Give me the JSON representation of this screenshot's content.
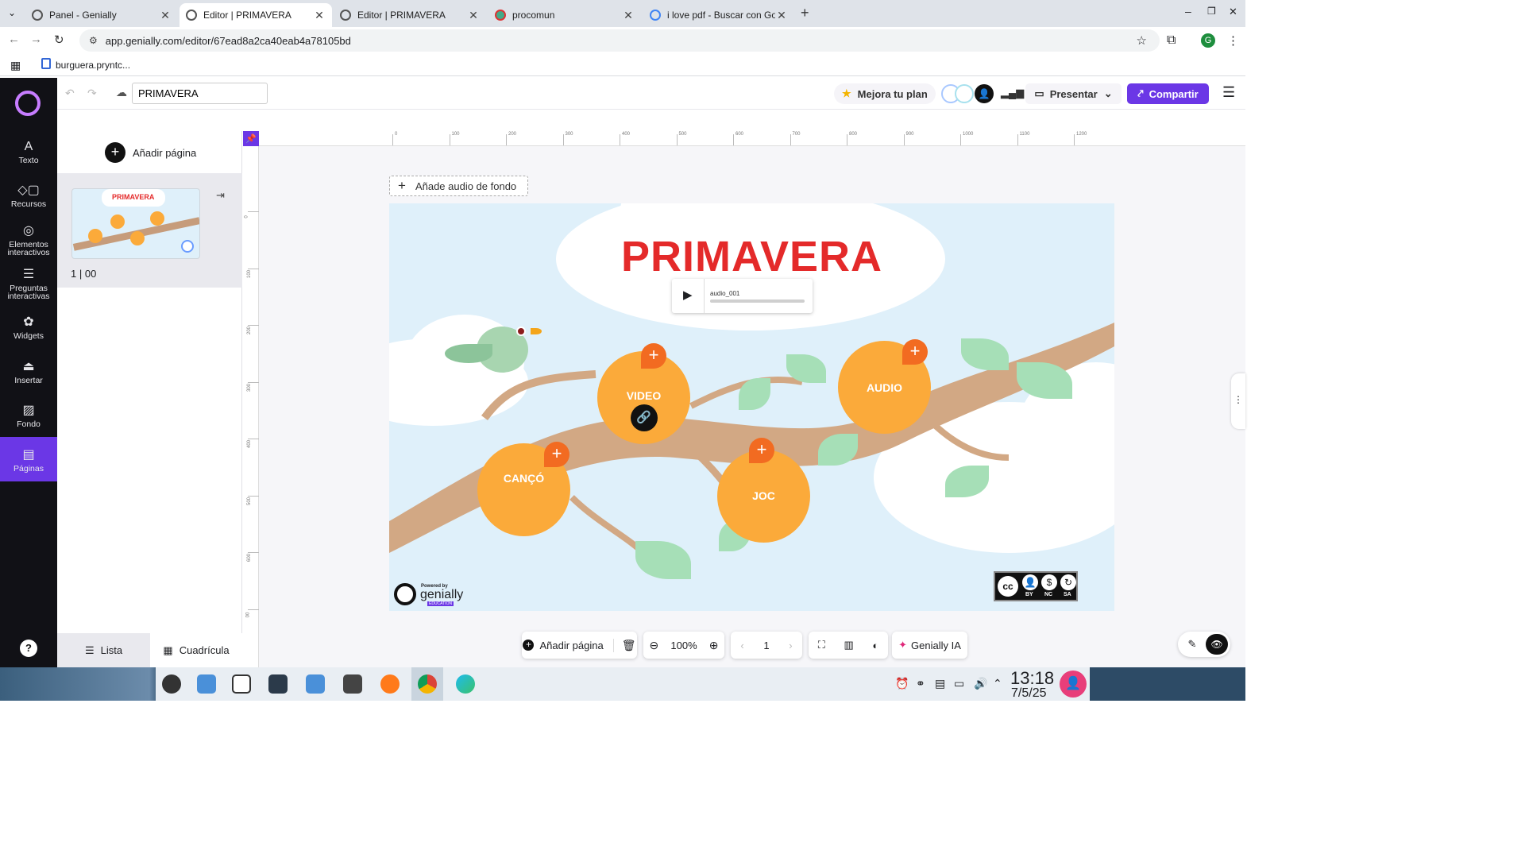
{
  "browser": {
    "tabs": [
      {
        "title": "Panel - Genially",
        "active": false
      },
      {
        "title": "Editor | PRIMAVERA",
        "active": true
      },
      {
        "title": "Editor | PRIMAVERA",
        "active": false
      },
      {
        "title": "procomun",
        "active": false
      },
      {
        "title": "i love pdf - Buscar con Goo",
        "active": false
      }
    ],
    "url": "app.genially.com/editor/67ead8a2ca40eab4a78105bd",
    "bookmark": "burguera.pryntc...",
    "profile_initial": "G"
  },
  "sidebar": {
    "items": [
      {
        "label": "Texto",
        "icon": "text-icon"
      },
      {
        "label": "Recursos",
        "icon": "shapes-icon"
      },
      {
        "label": "Elementos interactivos",
        "icon": "interactive-icon"
      },
      {
        "label": "Preguntas interactivas",
        "icon": "questions-icon"
      },
      {
        "label": "Widgets",
        "icon": "widgets-icon"
      },
      {
        "label": "Insertar",
        "icon": "insert-icon"
      },
      {
        "label": "Fondo",
        "icon": "background-icon"
      },
      {
        "label": "Páginas",
        "icon": "pages-icon",
        "selected": true
      }
    ],
    "help": "?"
  },
  "header": {
    "title_value": "PRIMAVERA",
    "upgrade": "Mejora tu plan",
    "present": "Presentar",
    "share": "Compartir"
  },
  "pages_panel": {
    "add_page": "Añadir página",
    "thumb_title": "PRIMAVERA",
    "page_number": "1",
    "page_time": "00",
    "view_list": "Lista",
    "view_grid": "Cuadrícula"
  },
  "ruler": {
    "h_ticks": [
      "0",
      "100",
      "200",
      "300",
      "400",
      "500",
      "600",
      "700",
      "800",
      "900",
      "1000",
      "1100",
      "1200"
    ],
    "v_ticks": [
      "0",
      "100",
      "200",
      "300",
      "400",
      "500",
      "600",
      "00"
    ]
  },
  "slide": {
    "add_audio": "Añade audio de fondo",
    "title": "PRIMAVERA",
    "audio_label": "audio_001",
    "buttons": [
      {
        "label": "VIDEO"
      },
      {
        "label": "AUDIO"
      },
      {
        "label": "CANÇÓ"
      },
      {
        "label": "JOC"
      }
    ],
    "powered_by": "Powered by",
    "brand": "genially",
    "edition": "EDUCATION",
    "license": [
      "BY",
      "NC",
      "SA"
    ]
  },
  "bottom_bar": {
    "add_page": "Añadir página",
    "zoom": "100%",
    "page": "1",
    "ai": "Genially IA"
  },
  "taskbar": {
    "time": "13:18",
    "date": "7/5/25"
  },
  "colors": {
    "accent": "#6b37e6",
    "title_red": "#e42a2a",
    "circle_orange": "#fbaa3a",
    "plus_orange": "#f26b21",
    "sky": "#dff0fa"
  }
}
